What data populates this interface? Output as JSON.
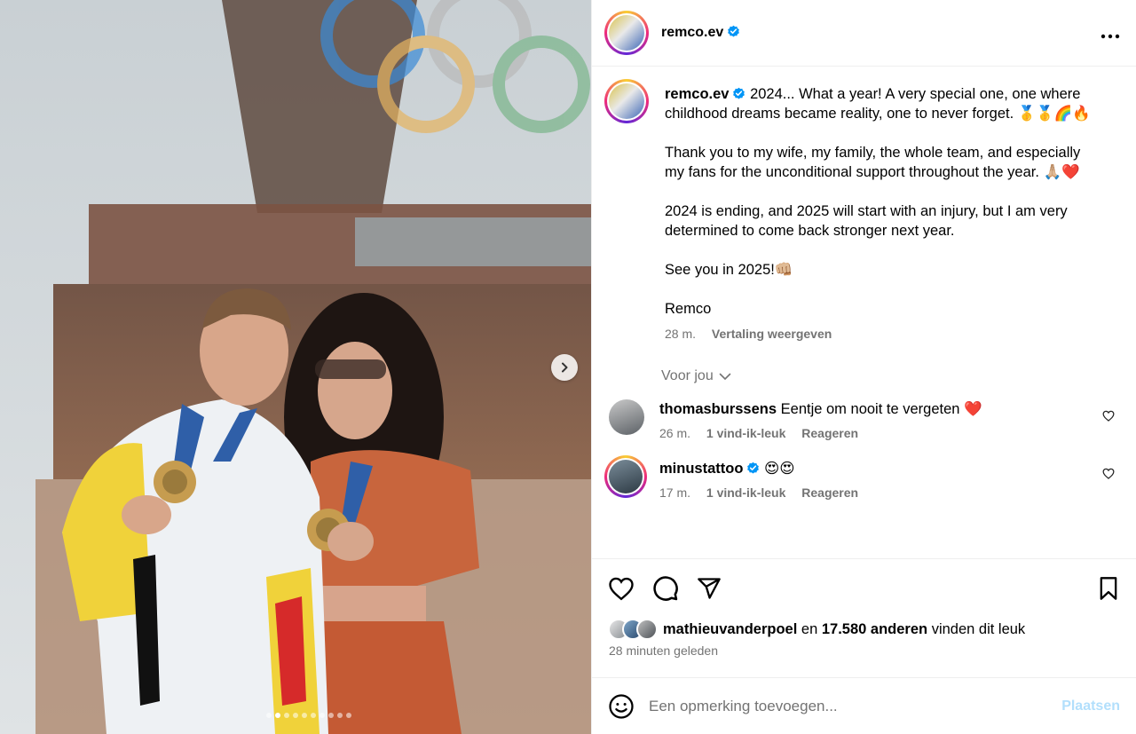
{
  "post": {
    "username": "remco.ev",
    "more_icon": "more-horizontal-icon",
    "caption": {
      "username": "remco.ev",
      "paragraphs": [
        "2024... What a year! A very special one, one where childhood dreams became reality, one to never forget. 🥇🥇🌈🔥",
        "Thank you to my wife, my family, the whole team, and especially my fans for the unconditional support throughout the year. 🙏🏼❤️",
        "2024 is ending, and 2025 will start with an injury, but I am very determined to come back stronger next year.",
        "See you in 2025!👊🏼",
        "Remco"
      ],
      "time": "28 m.",
      "translate": "Vertaling weergeven"
    },
    "for_you": "Voor jou",
    "comments": [
      {
        "username": "thomasburssens",
        "text": "Eentje om nooit te vergeten ❤️",
        "time": "26 m.",
        "likes": "1 vind-ik-leuk",
        "reply": "Reageren"
      },
      {
        "username": "minustattoo",
        "text": "😍😍",
        "time": "17 m.",
        "likes": "1 vind-ik-leuk",
        "reply": "Reageren"
      }
    ],
    "likes": {
      "user": "mathieuvanderpoel",
      "connector": "en",
      "others": "17.580 anderen",
      "suffix": "vinden dit leuk"
    },
    "posted_ago": "28 minuten geleden",
    "add_comment": {
      "placeholder": "Een opmerking toevoegen...",
      "post_label": "Plaatsen"
    }
  },
  "carousel": {
    "count": 10,
    "active_index": 1
  },
  "colors": {
    "verified": "#0095f6",
    "muted": "#737373",
    "post_disabled": "#b2dffc",
    "heart": "#ed4956"
  }
}
